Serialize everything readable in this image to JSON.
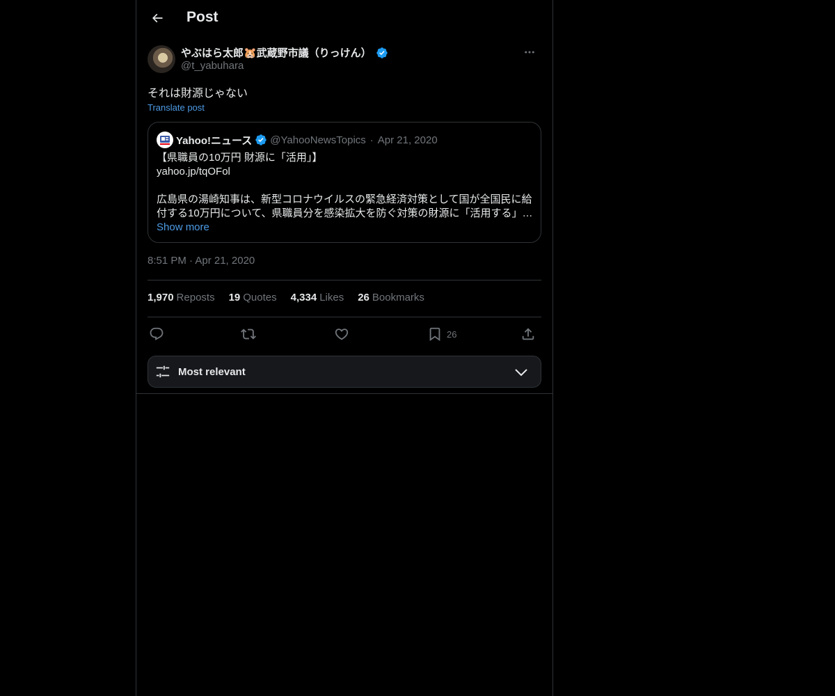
{
  "header": {
    "title": "Post"
  },
  "post": {
    "display_name": "やぶはら太郎🐹武蔵野市議（りっけん）",
    "handle": "@t_yabuhara",
    "text": "それは財源じゃない",
    "translate_label": "Translate post",
    "timestamp": "8:51 PM · Apr 21, 2020"
  },
  "quote": {
    "name": "Yahoo!ニュース",
    "handle": "@YahooNewsTopics",
    "separator": "·",
    "date": "Apr 21, 2020",
    "lines": [
      "【県職員の10万円 財源に「活用」】",
      "yahoo.jp/tqOFol",
      "",
      "広島県の湯崎知事は、新型コロナウイルスの緊急経済対策として国が全国民に給",
      "付する10万円について、県職員分を感染拡大を防ぐ対策の財源に「活用する」…"
    ],
    "show_more": "Show more"
  },
  "stats": {
    "reposts_count": "1,970",
    "reposts_label": "Reposts",
    "quotes_count": "19",
    "quotes_label": "Quotes",
    "likes_count": "4,334",
    "likes_label": "Likes",
    "bookmarks_count": "26",
    "bookmarks_label": "Bookmarks"
  },
  "actions": {
    "bookmark_count": "26"
  },
  "sort": {
    "label": "Most relevant"
  },
  "icons": {
    "back": "arrow-left-icon",
    "verified": "verified-badge-icon",
    "more": "more-horizontal-icon",
    "reply": "reply-icon",
    "repost": "repost-icon",
    "like": "heart-icon",
    "bookmark": "bookmark-icon",
    "share": "share-icon",
    "sort": "sliders-icon",
    "chevron": "chevron-down-icon"
  },
  "colors": {
    "background": "#000000",
    "text": "#e7e9ea",
    "muted": "#71767b",
    "link": "#4d9be5",
    "verified": "#1d9bf0",
    "border": "#2f3336"
  }
}
